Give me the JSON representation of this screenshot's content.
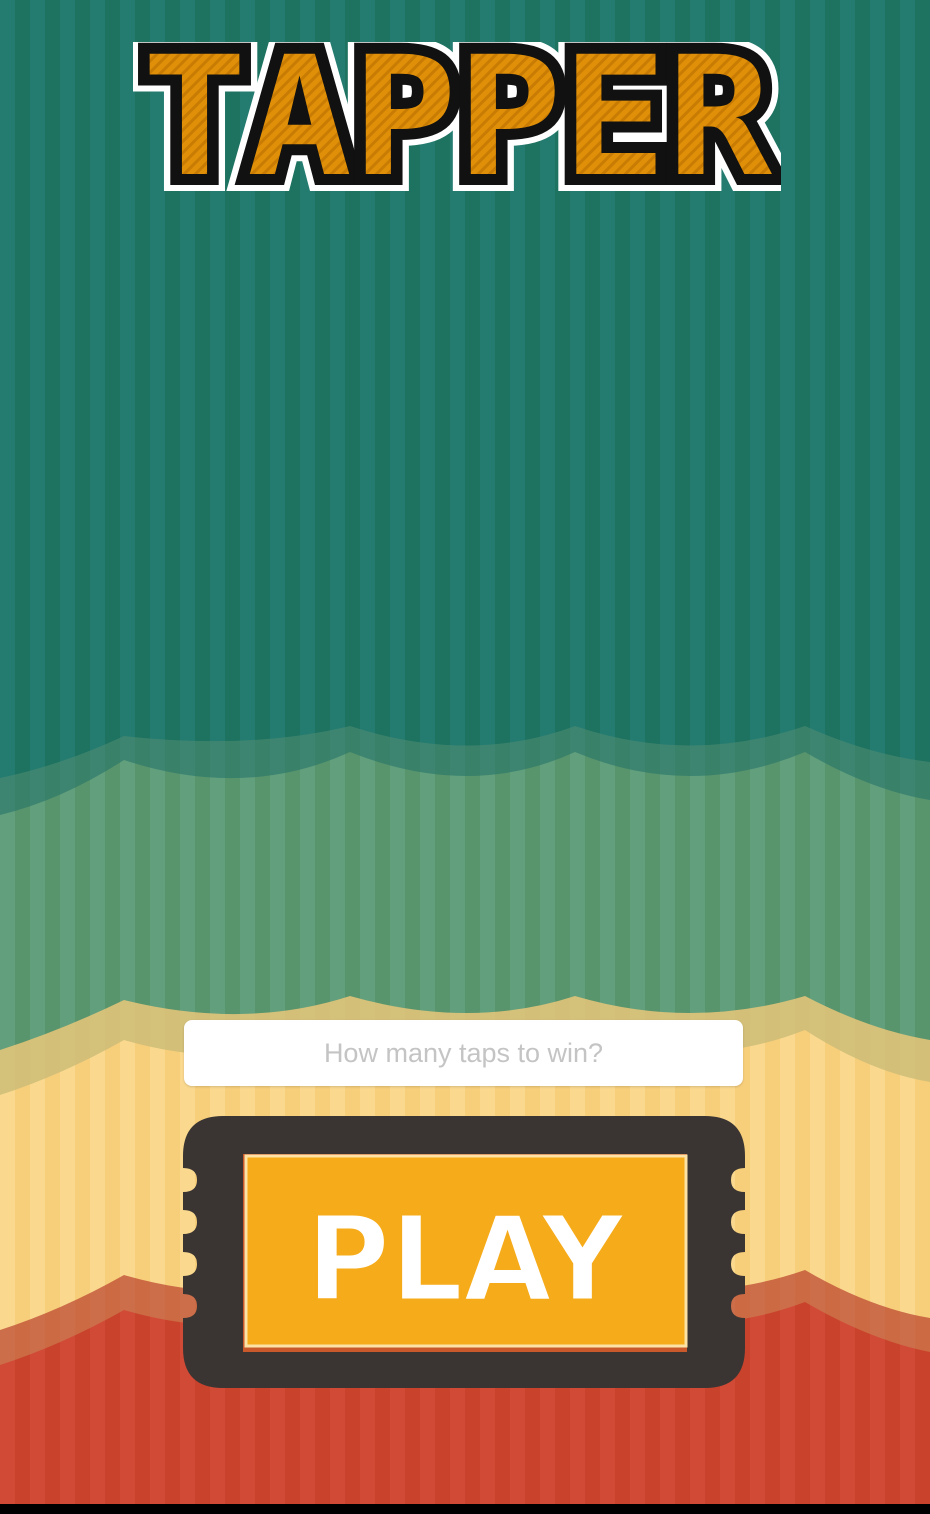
{
  "app": {
    "title": "TAPPER"
  },
  "taps_input": {
    "placeholder": "How many taps to win?",
    "value": ""
  },
  "play_button": {
    "label": "PLAY"
  },
  "colors": {
    "curtain_teal": "#237a6f",
    "curtain_green": "#5e9f7b",
    "curtain_yellow": "#f9d489",
    "curtain_red": "#cd4731",
    "title_fill": "#db8c07",
    "title_outline": "#111111",
    "ticket_frame": "#3a3533",
    "ticket_fill": "#f6ab1a",
    "ticket_text": "#ffffff"
  }
}
